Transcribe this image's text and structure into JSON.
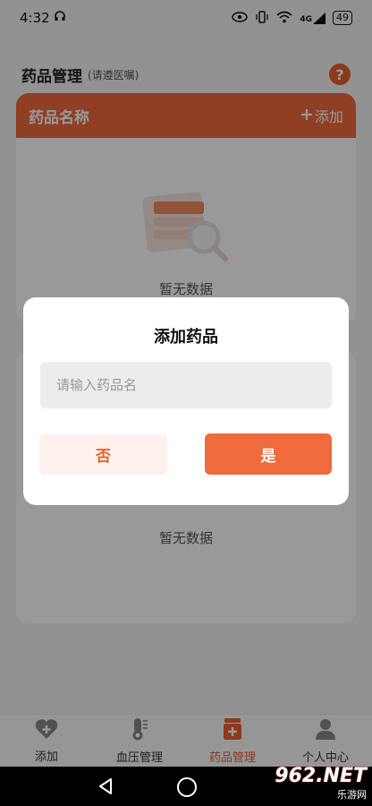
{
  "status_bar": {
    "time": "4:32",
    "network": "4G",
    "battery": "49"
  },
  "header": {
    "title": "药品管理",
    "subtitle": "(请遵医嘱)",
    "help_icon": "question-circle-icon"
  },
  "card1": {
    "title": "药品名称",
    "add_label": "添加",
    "empty_text": "暂无数据"
  },
  "card2": {
    "empty_text": "暂无数据"
  },
  "dialog": {
    "title": "添加药品",
    "input_placeholder": "请输入药品名",
    "input_value": "",
    "no_label": "否",
    "yes_label": "是"
  },
  "tabs": [
    {
      "label": "添加",
      "icon": "heart-plus-icon",
      "active": false
    },
    {
      "label": "血压管理",
      "icon": "thermometer-icon",
      "active": false
    },
    {
      "label": "药品管理",
      "icon": "medicine-box-icon",
      "active": true
    },
    {
      "label": "个人中心",
      "icon": "user-icon",
      "active": false
    }
  ],
  "watermark": {
    "main": "962.NET",
    "sub": "乐游网"
  },
  "colors": {
    "accent": "#ee6a3d",
    "accent_light": "#fdf1ee",
    "text": "#222222"
  }
}
